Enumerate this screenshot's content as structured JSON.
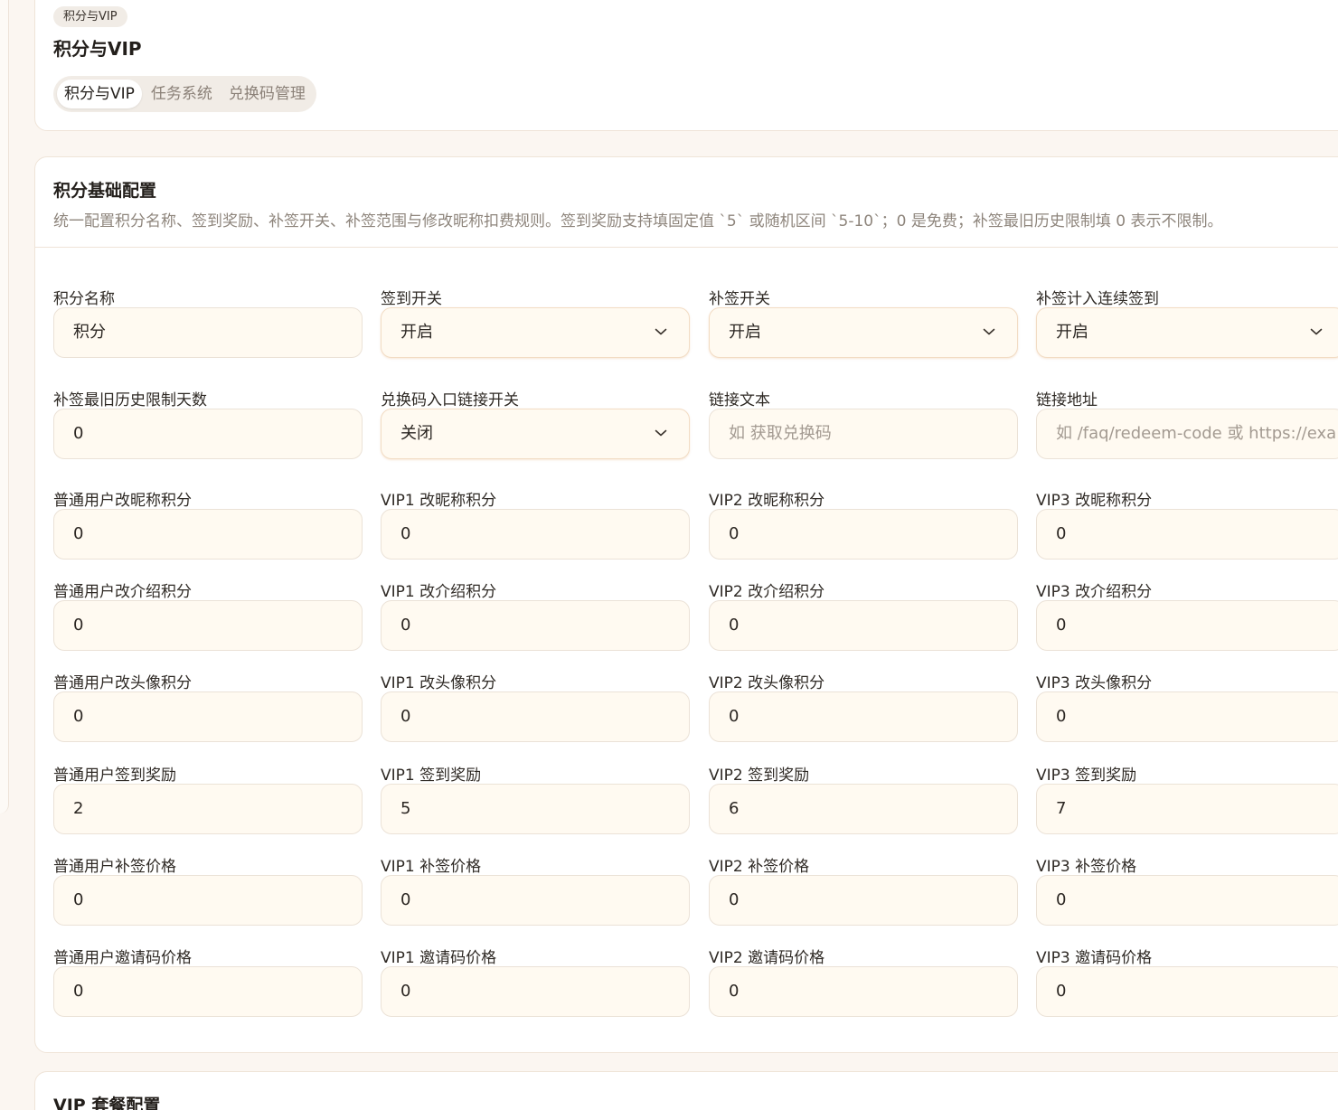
{
  "header": {
    "badge": "积分与VIP",
    "title": "积分与VIP",
    "tabs": [
      {
        "label": "积分与VIP",
        "active": true
      },
      {
        "label": "任务系统",
        "active": false
      },
      {
        "label": "兑换码管理",
        "active": false
      }
    ]
  },
  "config": {
    "title": "积分基础配置",
    "description": "统一配置积分名称、签到奖励、补签开关、补签范围与修改昵称扣费规则。签到奖励支持填固定值 `5` 或随机区间 `5-10`；0 是免费；补签最旧历史限制填 0 表示不限制。",
    "rows": [
      [
        {
          "label": "积分名称",
          "value": "积分",
          "type": "text"
        },
        {
          "label": "签到开关",
          "value": "开启",
          "type": "select"
        },
        {
          "label": "补签开关",
          "value": "开启",
          "type": "select"
        },
        {
          "label": "补签计入连续签到",
          "value": "开启",
          "type": "select"
        }
      ],
      [
        {
          "label": "补签最旧历史限制天数",
          "value": "0",
          "type": "text"
        },
        {
          "label": "兑换码入口链接开关",
          "value": "关闭",
          "type": "select"
        },
        {
          "label": "链接文本",
          "value": "",
          "placeholder": "如 获取兑换码",
          "type": "text"
        },
        {
          "label": "链接地址",
          "value": "",
          "placeholder": "如 /faq/redeem-code 或 https://exa",
          "type": "text"
        }
      ],
      [
        {
          "label": "普通用户改昵称积分",
          "value": "0",
          "type": "text"
        },
        {
          "label": "VIP1 改昵称积分",
          "value": "0",
          "type": "text"
        },
        {
          "label": "VIP2 改昵称积分",
          "value": "0",
          "type": "text"
        },
        {
          "label": "VIP3 改昵称积分",
          "value": "0",
          "type": "text"
        }
      ],
      [
        {
          "label": "普通用户改介绍积分",
          "value": "0",
          "type": "text"
        },
        {
          "label": "VIP1 改介绍积分",
          "value": "0",
          "type": "text"
        },
        {
          "label": "VIP2 改介绍积分",
          "value": "0",
          "type": "text"
        },
        {
          "label": "VIP3 改介绍积分",
          "value": "0",
          "type": "text"
        }
      ],
      [
        {
          "label": "普通用户改头像积分",
          "value": "0",
          "type": "text"
        },
        {
          "label": "VIP1 改头像积分",
          "value": "0",
          "type": "text"
        },
        {
          "label": "VIP2 改头像积分",
          "value": "0",
          "type": "text"
        },
        {
          "label": "VIP3 改头像积分",
          "value": "0",
          "type": "text"
        }
      ],
      [
        {
          "label": "普通用户签到奖励",
          "value": "2",
          "type": "text"
        },
        {
          "label": "VIP1 签到奖励",
          "value": "5",
          "type": "text"
        },
        {
          "label": "VIP2 签到奖励",
          "value": "6",
          "type": "text"
        },
        {
          "label": "VIP3 签到奖励",
          "value": "7",
          "type": "text"
        }
      ],
      [
        {
          "label": "普通用户补签价格",
          "value": "0",
          "type": "text"
        },
        {
          "label": "VIP1 补签价格",
          "value": "0",
          "type": "text"
        },
        {
          "label": "VIP2 补签价格",
          "value": "0",
          "type": "text"
        },
        {
          "label": "VIP3 补签价格",
          "value": "0",
          "type": "text"
        }
      ],
      [
        {
          "label": "普通用户邀请码价格",
          "value": "0",
          "type": "text"
        },
        {
          "label": "VIP1 邀请码价格",
          "value": "0",
          "type": "text"
        },
        {
          "label": "VIP2 邀请码价格",
          "value": "0",
          "type": "text"
        },
        {
          "label": "VIP3 邀请码价格",
          "value": "0",
          "type": "text"
        }
      ]
    ]
  },
  "vip_section": {
    "title": "VIP 套餐配置"
  },
  "icons": {
    "select_chevron": "chevron-down-icon"
  }
}
